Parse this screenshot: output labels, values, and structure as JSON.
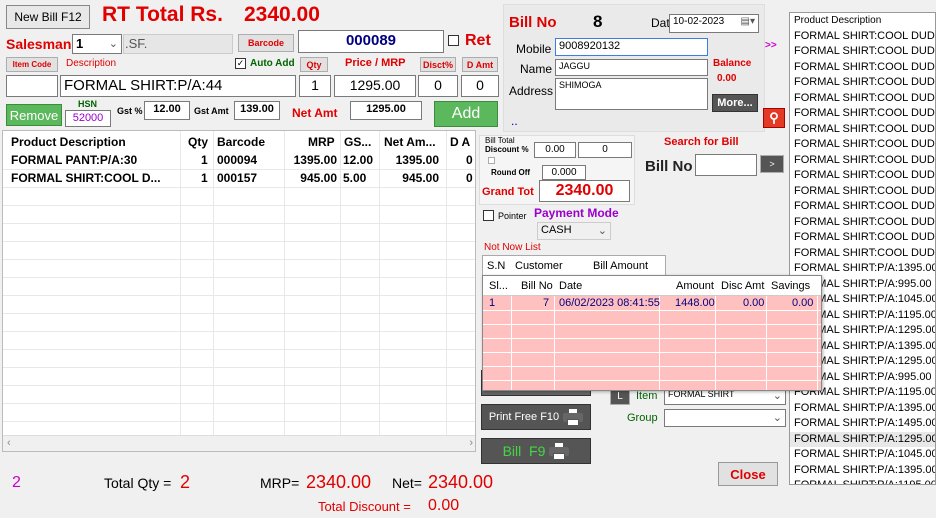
{
  "header": {
    "new_bill_label": "New Bill F12",
    "rt_total_label": "RT Total Rs.",
    "rt_total_value": "2340.00"
  },
  "form": {
    "salesman_label": "Salesman",
    "salesman_value": "1",
    "sf_label": ".SF.",
    "barcode_button": "Barcode",
    "barcode_value": "000089",
    "ret_label": "Ret",
    "item_code_button": "Item Code",
    "description_label": "Description",
    "auto_add_label": "Auto Add",
    "qty_button": "Qty",
    "price_mrp_label": "Price / MRP",
    "disct_button": "Disct%",
    "damt_button": "D Amt",
    "item_code_value": "",
    "description_value": "FORMAL SHIRT:P/A:44",
    "qty_value": "1",
    "price_value": "1295.00",
    "disct_value": "0",
    "damt_value": "0",
    "remove_button": "Remove",
    "hsn_label": "HSN",
    "hsn_value": "52000",
    "gst_pct_label": "Gst %",
    "gst_pct_value": "12.00",
    "gst_amt_label": "Gst Amt",
    "gst_amt_value": "139.00",
    "net_amt_label": "Net Amt",
    "net_amt_value": "1295.00",
    "add_button": "Add"
  },
  "grid": {
    "headers": [
      "Product Description",
      "Qty",
      "Barcode",
      "MRP",
      "GS...",
      "Net Am...",
      "D A"
    ],
    "rows": [
      [
        "FORMAL PANT:P/A:30",
        "1",
        "000094",
        "1395.00",
        "12.00",
        "1395.00",
        "0"
      ],
      [
        "FORMAL SHIRT:COOL D...",
        "1",
        "000157",
        "945.00",
        "5.00",
        "945.00",
        "0"
      ]
    ]
  },
  "footer": {
    "count": "2",
    "total_qty_label": "Total Qty =",
    "total_qty_value": "2",
    "mrp_label": "MRP=",
    "mrp_value": "2340.00",
    "net_label": "Net=",
    "net_value": "2340.00",
    "total_discount_label": "Total Discount =",
    "total_discount_value": "0.00"
  },
  "bill": {
    "bill_no_label": "Bill No",
    "bill_no_value": "8",
    "date_label": "Date",
    "date_value": "10-02-2023",
    "mobile_label": "Mobile",
    "mobile_value": "9008920132",
    "name_label": "Name",
    "name_value": "JAGGU",
    "address_label": "Address",
    "address_value": "SHIMOGA",
    "balance_label": "Balance",
    "balance_value": "0.00",
    "more_button": "More...",
    "dots": "..",
    "arrow_label": ">>"
  },
  "totals": {
    "bill_total_label": "Bill Total",
    "discount_label": "Discount %",
    "discount_pct": "0.00",
    "discount_amt": "0",
    "round_off_label": "Round Off",
    "round_off_value": "0.000",
    "grand_tot_label": "Grand Tot",
    "grand_tot_value": "2340.00",
    "search_bill_label": "Search for Bill",
    "search_bill_no_label": "Bill No",
    "search_go": ">",
    "pointer_label": "Pointer",
    "payment_mode_label": "Payment Mode",
    "payment_mode_value": "CASH"
  },
  "not_now": {
    "title": "Not Now List",
    "headers": [
      "S.N",
      "Customer",
      "Bill Amount"
    ]
  },
  "popup": {
    "headers": [
      "Sl...",
      "Bill No",
      "Date",
      "Amount",
      "Disc Amt",
      "Savings"
    ],
    "rows": [
      [
        "1",
        "7",
        "06/02/2023 08:41:55",
        "1448.00",
        "0.00",
        "0.00"
      ]
    ]
  },
  "actions": {
    "print_free_label": "Print Free F10",
    "bill_f9_label": "Bill",
    "bill_f9_key": "F9",
    "l_button": "L",
    "item_label": "Item",
    "item_value": "FORMAL SHIRT",
    "group_label": "Group",
    "group_value": "",
    "close_button": "Close"
  },
  "product_list": {
    "header": "Product Description",
    "items": [
      "FORMAL SHIRT:COOL DUDE:",
      "FORMAL SHIRT:COOL DUDE:",
      "FORMAL SHIRT:COOL DUDE:",
      "FORMAL SHIRT:COOL DUDE:",
      "FORMAL SHIRT:COOL DUDE:",
      "FORMAL SHIRT:COOL DUDE:",
      "FORMAL SHIRT:COOL DUDE:",
      "FORMAL SHIRT:COOL DUDE:",
      "FORMAL SHIRT:COOL DUDE:",
      "FORMAL SHIRT:COOL DUDE:",
      "FORMAL SHIRT:COOL DUDE:",
      "FORMAL SHIRT:COOL DUDE:",
      "FORMAL SHIRT:COOL DUDE:",
      "FORMAL SHIRT:COOL DUDE:",
      "FORMAL SHIRT:COOL DUDE:",
      "FORMAL SHIRT:P/A:1395.00",
      "FORMAL SHIRT:P/A:995.00",
      "FORMAL SHIRT:P/A:1045.00",
      "FORMAL SHIRT:P/A:1195.00",
      "FORMAL SHIRT:P/A:1295.00",
      "FORMAL SHIRT:P/A:1395.00",
      "FORMAL SHIRT:P/A:1295.00",
      "FORMAL SHIRT:P/A:995.00",
      "FORMAL SHIRT:P/A:1195.00",
      "FORMAL SHIRT:P/A:1395.00",
      "FORMAL SHIRT:P/A:1495.00",
      "FORMAL SHIRT:P/A:1295.00",
      "FORMAL SHIRT:P/A:1045.00",
      "FORMAL SHIRT:P/A:1395.00",
      "FORMAL SHIRT:P/A:1195.00"
    ]
  },
  "colors": {
    "red": "#e00000",
    "green_button": "#5cb85c",
    "pink": "#ffc0c0",
    "navy": "#000080",
    "purple": "#9900cc"
  }
}
